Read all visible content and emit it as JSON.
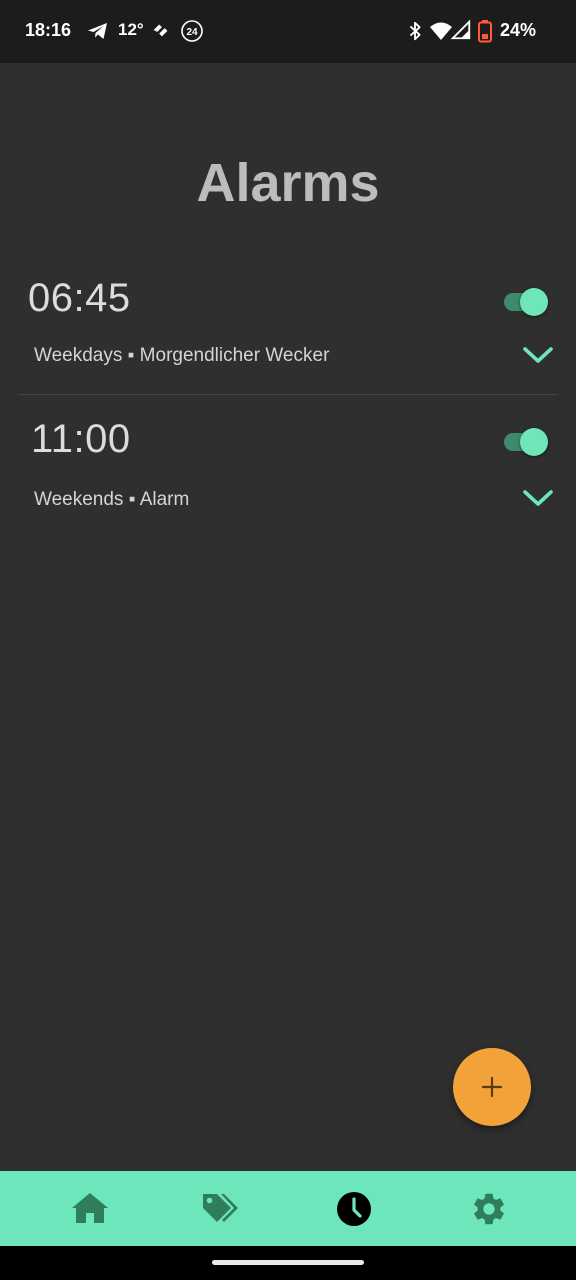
{
  "status_bar": {
    "time": "18:16",
    "temperature": "12°",
    "notification_badge": "24",
    "battery_percent": "24%",
    "icons": [
      "telegram-icon",
      "weather-app-icon",
      "news24-icon",
      "bluetooth-icon",
      "wifi-icon",
      "signal-icon",
      "battery-low-icon"
    ]
  },
  "page": {
    "title": "Alarms"
  },
  "alarms": [
    {
      "time": "06:45",
      "enabled": true,
      "days": "Weekdays",
      "separator": "▪",
      "label": "Morgendlicher Wecker"
    },
    {
      "time": "11:00",
      "enabled": true,
      "days": "Weekends",
      "separator": "▪",
      "label": "Alarm"
    }
  ],
  "fab": {
    "icon": "plus-icon"
  },
  "bottom_nav": {
    "items": [
      {
        "icon": "home-icon",
        "active": false
      },
      {
        "icon": "tags-icon",
        "active": false
      },
      {
        "icon": "clock-icon",
        "active": true
      },
      {
        "icon": "gear-icon",
        "active": false
      }
    ]
  },
  "colors": {
    "background": "#2f2f2f",
    "status_bar": "#1c1c1c",
    "accent": "#6ee6bc",
    "toggle_track": "#3f8a6c",
    "fab": "#f3a23a",
    "nav_icon": "#2e7d5b",
    "title": "#bcbcbc",
    "battery_warning": "#ff5a3c"
  }
}
